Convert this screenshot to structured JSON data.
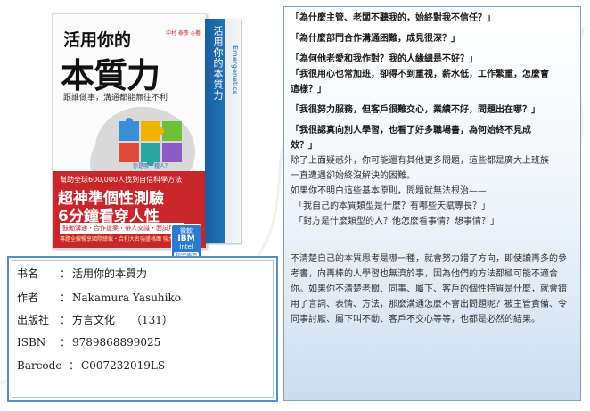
{
  "book_cover": {
    "title_small": "活用你的",
    "title_big": "本質力",
    "subtitle": "跟誰做事，溝通都能無往不利",
    "authors": "中村 泰彥 ◎著",
    "spine_title": "活用你的本質力",
    "spine_side": "Emergenetics",
    "band_small": "幫助全球600,000人找到自信科學方法",
    "band_big1": "超神準個性測驗",
    "band_big2": "6分鐘看穿人性",
    "band_chip": "鼓勵溝通・合作提案・帶人交識・面試用人",
    "band_foot": "專題全線暢享國際總裁・合利大名強盛格團 強力推薦",
    "badge": {
      "line1": "微軟",
      "line2": "IBM",
      "line3": "Intel",
      "line4": "指定使用"
    }
  },
  "info": {
    "title_label": "书名",
    "title_sep": "：",
    "title_value": "活用你的本質力",
    "author_label": "作者",
    "author_sep": "：",
    "author_value": "Nakamura Yasuhiko",
    "publisher_label": "出版社",
    "publisher_sep": "：",
    "publisher_value": "方言文化",
    "pages_value": "（131）",
    "isbn_label": "ISBN",
    "isbn_sep": "：",
    "isbn_value": "9789868899025",
    "barcode_label": "Barcode",
    "barcode_sep": "：",
    "barcode_value": "C007232019LS"
  },
  "text_panel": {
    "questions": [
      "「為什麼主管、老闆不聽我的，始終對我不信任？」",
      "「為什麼部門合作溝通困難，成見很深？」",
      "「為何他老愛和我作對？我的人緣總是不好？」",
      "「我很用心也常加班，卻得不到重視，薪水低，工作繁重，怎麼會",
      "這樣？」",
      "「我很努力服務，但客戶很難交心，業績不好，問題出在哪？」",
      "「我很認真向別人學習，也看了好多職場書，為何始終不見成",
      "效？」"
    ],
    "lines": [
      "除了上面疑惑外，你可能還有其他更多問題，這些都是廣大上班族",
      "一直遭遇卻始終沒解決的困難。",
      "如果你不明白這些基本原則，問題就無法根治——",
      "「我自己的本質類型是什麼？有哪些天賦專長？」",
      "「對方是什麼類型的人？他怎麼看事情？想事情？」"
    ],
    "paragraph": "不清楚自己的本質思考是哪一種，就會努力錯了方向，即使讀再多的參考書，向再棒的人學習也無濟於事，因為他們的方法都極可能不適合你。如果你不清楚老闆、同事、屬下、客戶的個性特質是什麼，就會錯用了言詞、表情、方法，那麼溝通怎麼不會出問題呢？被主管責備、令同事討厭、屬下叫不動、客戶不交心等等，也都是必然的結果。"
  }
}
